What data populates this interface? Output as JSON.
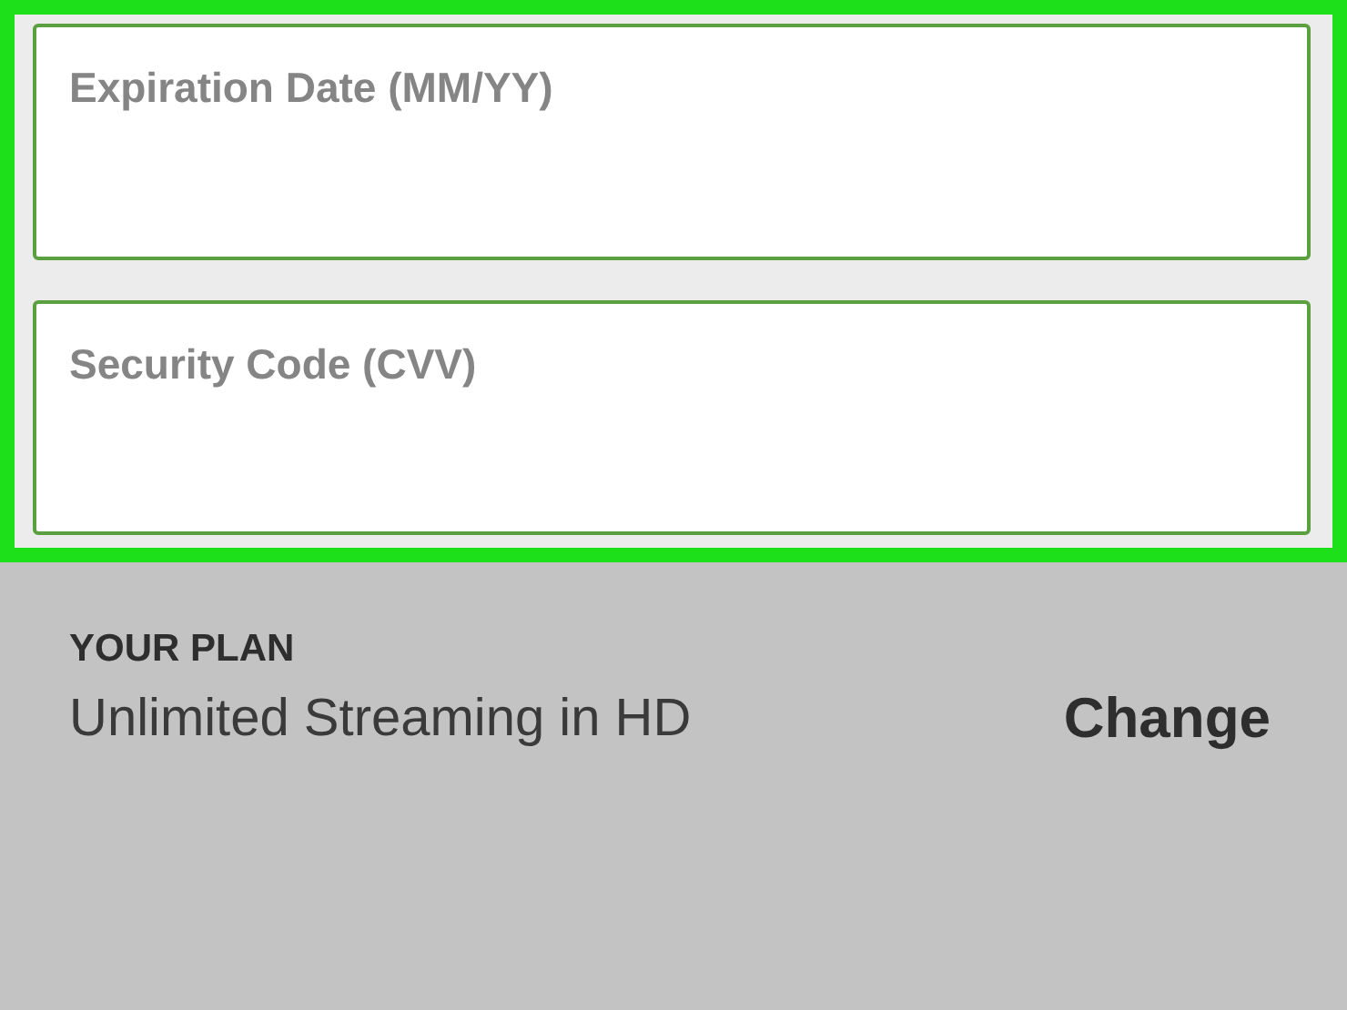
{
  "payment_fields": [
    {
      "label": "Expiration Date (MM/YY)"
    },
    {
      "label": "Security Code (CVV)"
    }
  ],
  "plan": {
    "heading": "YOUR PLAN",
    "name": "Unlimited Streaming in HD",
    "change_link": "Change"
  }
}
